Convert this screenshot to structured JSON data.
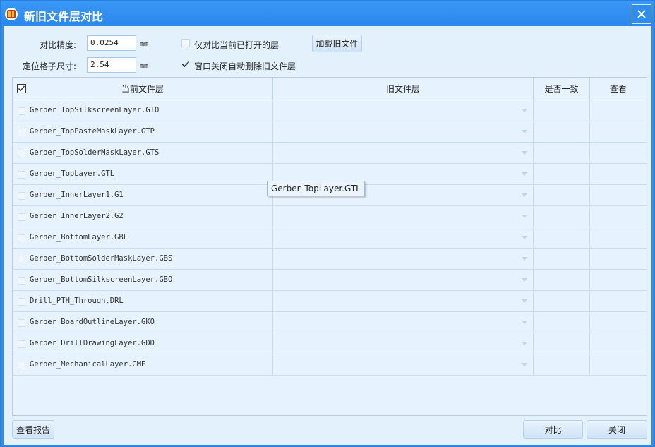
{
  "window": {
    "title": "新旧文件层对比",
    "close_icon": "close-icon",
    "app_icon": "app-logo-icon"
  },
  "settings": {
    "precision_label": "对比精度:",
    "precision_value": "0.0254",
    "precision_unit": "mm",
    "grid_label": "定位格子尺寸:",
    "grid_value": "2.54",
    "grid_unit": "mm",
    "only_open_label": "仅对比当前已打开的层",
    "only_open_checked": false,
    "auto_delete_label": "窗口关闭自动删除旧文件层",
    "auto_delete_checked": true,
    "load_old_button": "加载旧文件"
  },
  "table": {
    "columns": [
      "当前文件层",
      "旧文件层",
      "是否一致",
      "查看"
    ],
    "header_checkbox_checked": true,
    "rows": [
      {
        "current": "Gerber_TopSilkscreenLayer.GTO",
        "old": "",
        "match": "",
        "view": ""
      },
      {
        "current": "Gerber_TopPasteMaskLayer.GTP",
        "old": "",
        "match": "",
        "view": ""
      },
      {
        "current": "Gerber_TopSolderMaskLayer.GTS",
        "old": "",
        "match": "",
        "view": ""
      },
      {
        "current": "Gerber_TopLayer.GTL",
        "old": "",
        "match": "",
        "view": ""
      },
      {
        "current": "Gerber_InnerLayer1.G1",
        "old": "",
        "match": "",
        "view": ""
      },
      {
        "current": "Gerber_InnerLayer2.G2",
        "old": "",
        "match": "",
        "view": ""
      },
      {
        "current": "Gerber_BottomLayer.GBL",
        "old": "",
        "match": "",
        "view": ""
      },
      {
        "current": "Gerber_BottomSolderMaskLayer.GBS",
        "old": "",
        "match": "",
        "view": ""
      },
      {
        "current": "Gerber_BottomSilkscreenLayer.GBO",
        "old": "",
        "match": "",
        "view": ""
      },
      {
        "current": "Drill_PTH_Through.DRL",
        "old": "",
        "match": "",
        "view": ""
      },
      {
        "current": "Gerber_BoardOutlineLayer.GKO",
        "old": "",
        "match": "",
        "view": ""
      },
      {
        "current": "Gerber_DrillDrawingLayer.GDD",
        "old": "",
        "match": "",
        "view": ""
      },
      {
        "current": "Gerber_MechanicalLayer.GME",
        "old": "",
        "match": "",
        "view": ""
      }
    ]
  },
  "tooltip": "Gerber_TopLayer.GTL",
  "footer": {
    "report_button": "查看报告",
    "compare_button": "对比",
    "close_button": "关闭"
  },
  "colors": {
    "titlebar": "#2f8df0",
    "client_bg": "#e3f1fd"
  }
}
